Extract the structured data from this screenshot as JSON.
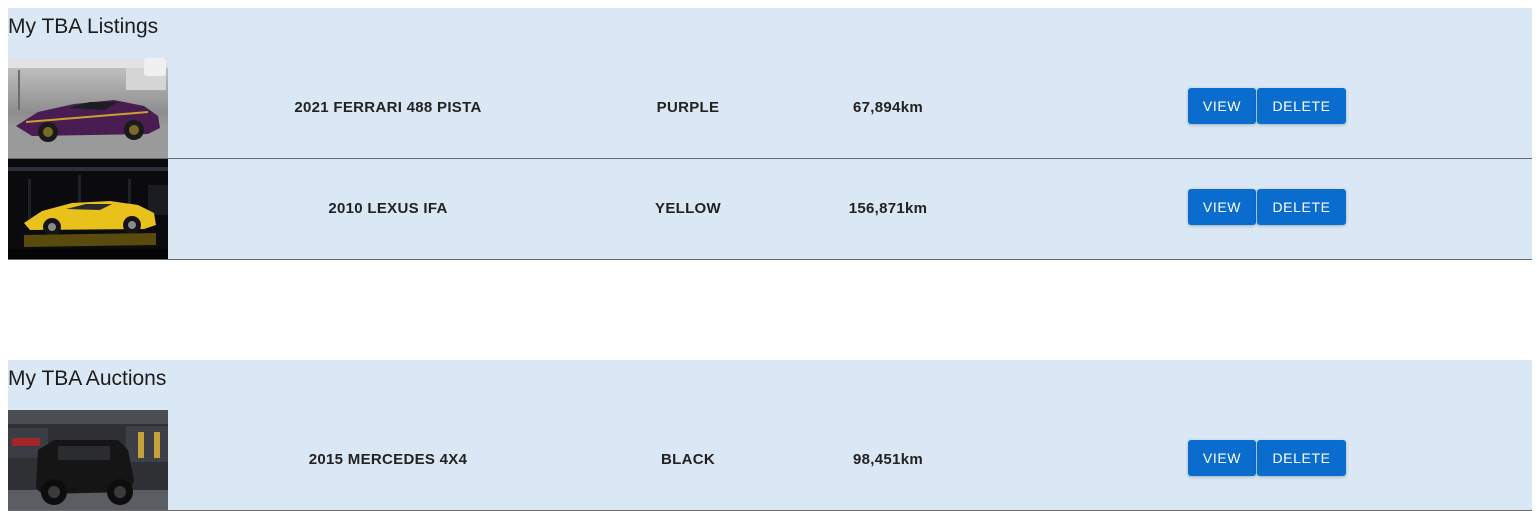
{
  "listings": {
    "title": "My TBA Listings",
    "rows": [
      {
        "name": "2021 FERRARI 488 PISTA",
        "color": "PURPLE",
        "mileage": "67,894km",
        "view_label": "VIEW",
        "delete_label": "DELETE",
        "car_color": "#5a1f5e"
      },
      {
        "name": "2010 LEXUS IFA",
        "color": "YELLOW",
        "mileage": "156,871km",
        "view_label": "VIEW",
        "delete_label": "DELETE",
        "car_color": "#e8c21a"
      }
    ]
  },
  "auctions": {
    "title": "My TBA Auctions",
    "rows": [
      {
        "name": "2015 MERCEDES 4X4",
        "color": "BLACK",
        "mileage": "98,451km",
        "view_label": "VIEW",
        "delete_label": "DELETE",
        "car_color": "#1b1b1b"
      }
    ]
  },
  "colors": {
    "section_background": "#dae8f5",
    "button_background": "#0a6ccc",
    "button_text": "#ffffff",
    "row_divider": "#6b6b6b"
  }
}
